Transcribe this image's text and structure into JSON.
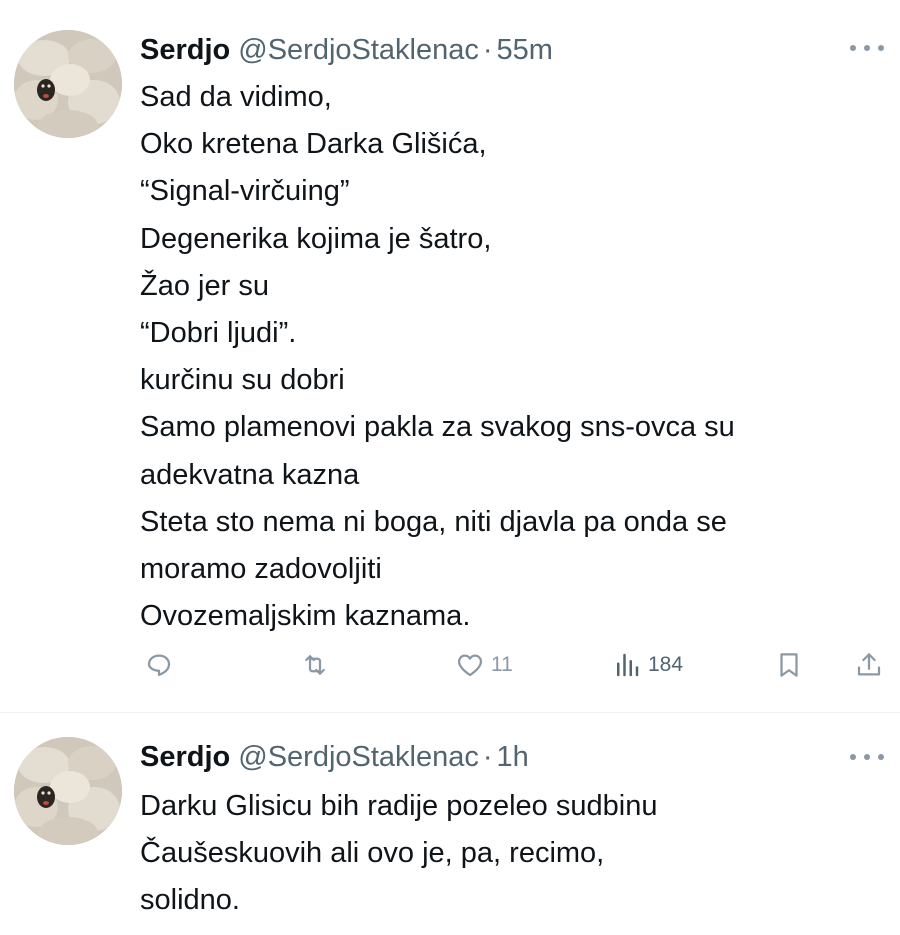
{
  "tweets": [
    {
      "author_name": "Serdjo",
      "handle": "@SerdjoStaklenac",
      "separator": "·",
      "time": "55m",
      "lines": [
        "Sad da vidimo,",
        "Oko kretena Darka Glišića,",
        "“Signal-virčuing”",
        "Degenerika kojima je šatro,",
        "Žao jer su",
        "“Dobri ljudi”.",
        "kurčinu su dobri",
        "Samo plamenovi pakla za svakog sns-ovca su",
        "adekvatna kazna",
        "Steta sto nema ni boga, niti djavla pa onda se",
        "moramo zadovoljiti",
        "Ovozemaljskim kaznama."
      ],
      "actions": {
        "likes": "11",
        "views": "184"
      }
    },
    {
      "author_name": "Serdjo",
      "handle": "@SerdjoStaklenac",
      "separator": "·",
      "time": "1h",
      "lines": [
        "Darku Glisicu bih radije pozeleo sudbinu",
        "Čaušeskuovih ali ovo je, pa, recimo,",
        "solidno."
      ]
    }
  ],
  "icons": {
    "reply": "reply-icon",
    "retweet": "retweet-icon",
    "like": "heart-icon",
    "views": "views-icon",
    "bookmark": "bookmark-icon",
    "share": "share-icon",
    "more": "more-icon"
  },
  "colors": {
    "text": "#0f1419",
    "secondary": "#536471",
    "icon": "#8b98a5",
    "divider": "#eff3f4"
  }
}
